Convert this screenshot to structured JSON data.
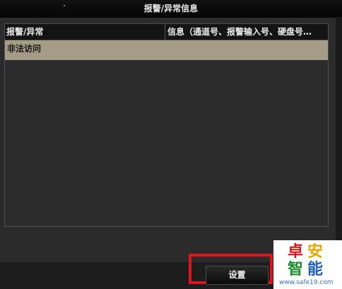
{
  "window": {
    "title": "报警/异常信息"
  },
  "table": {
    "columns": [
      {
        "label": "报警/异常"
      },
      {
        "label": "信息（通道号、报警输入号、硬盘号…"
      }
    ],
    "rows": [
      {
        "type": "非法访问",
        "info": ""
      }
    ]
  },
  "footer": {
    "settings_label": "设置"
  },
  "watermark": {
    "chars": [
      "卓",
      "安",
      "智",
      "能"
    ],
    "url": "www.safe19.com"
  },
  "colors": {
    "selected_row": "#a49c86",
    "highlight_border": "#e0141b",
    "background": "#2b2b2b"
  }
}
